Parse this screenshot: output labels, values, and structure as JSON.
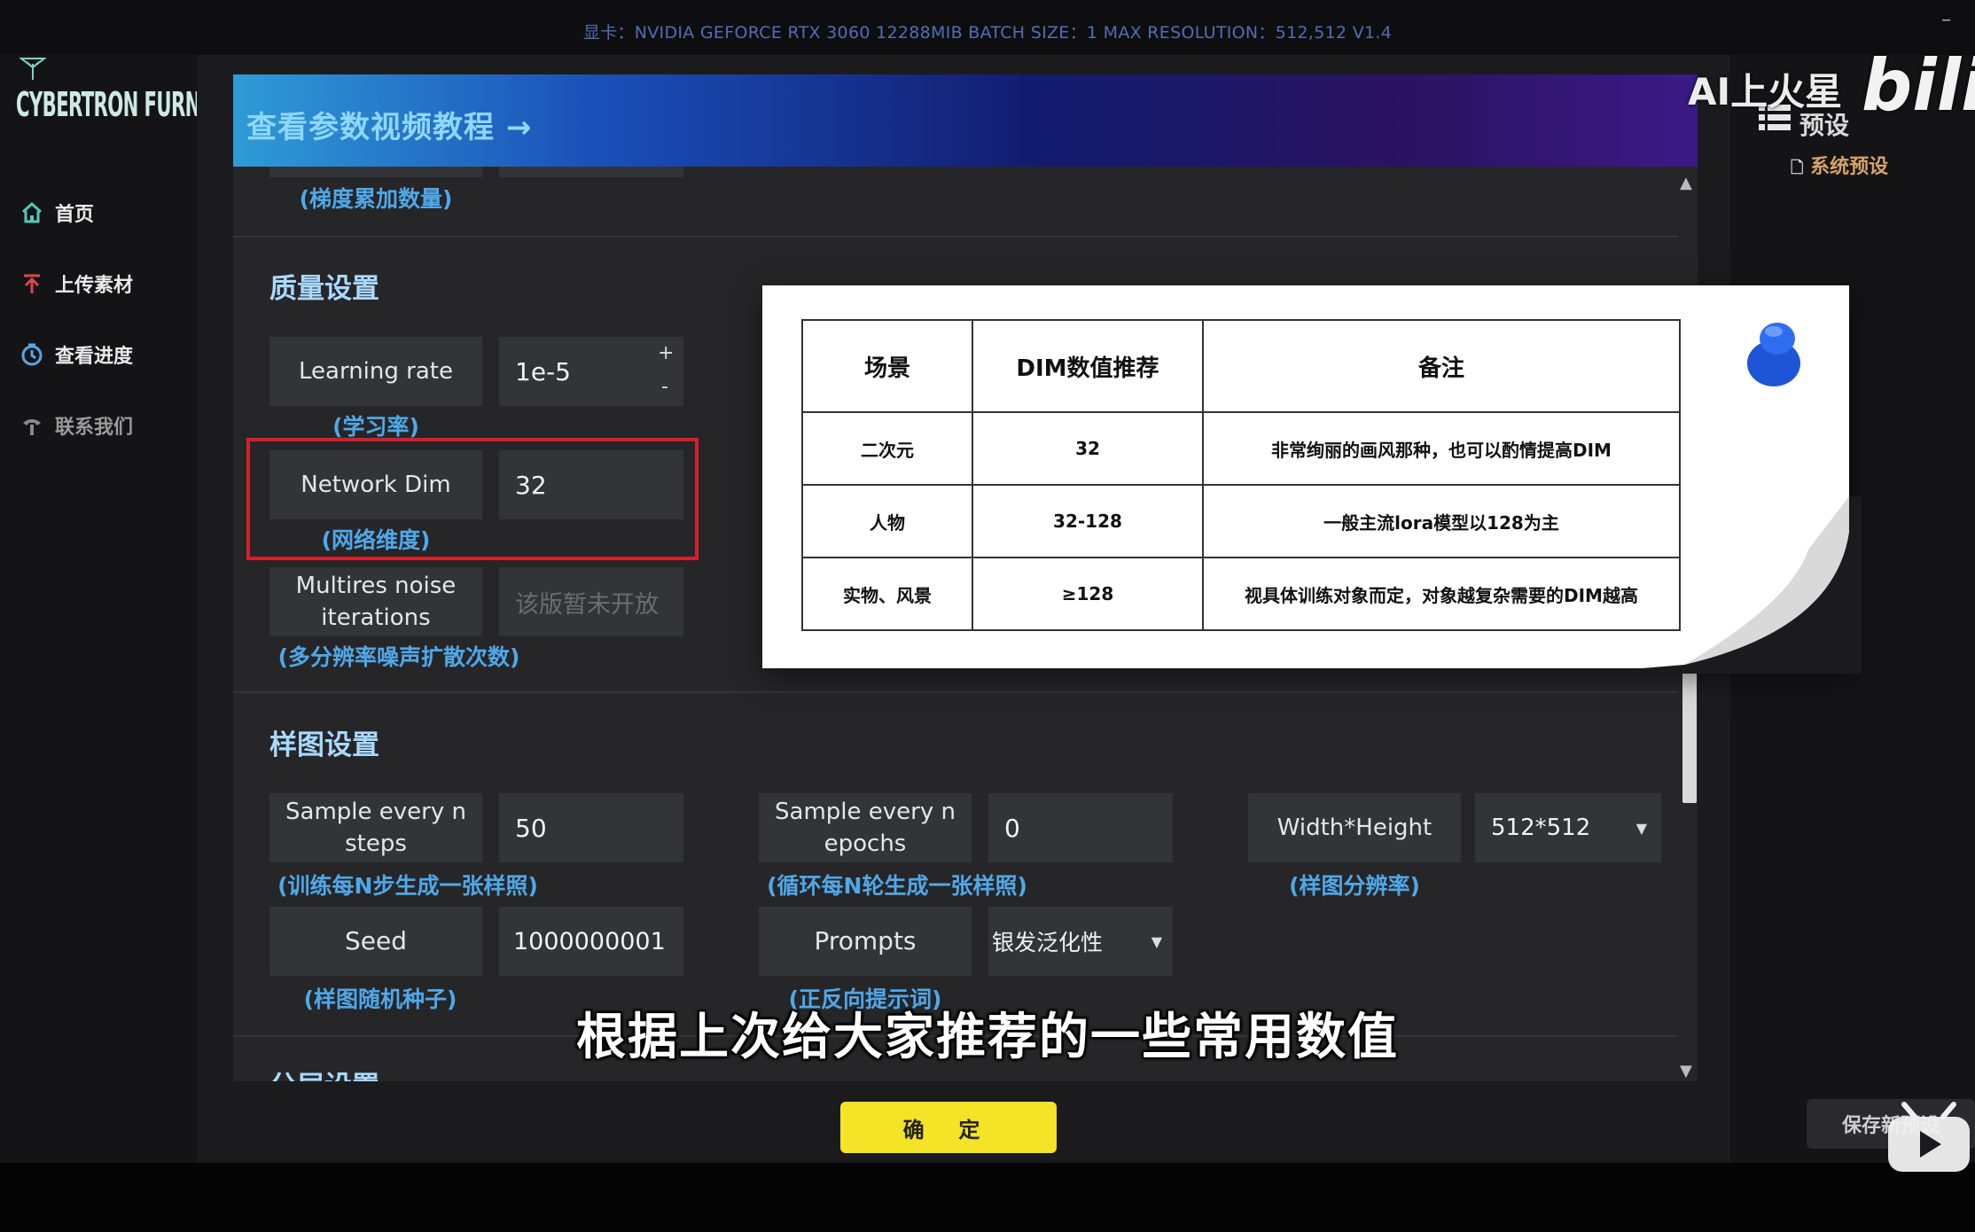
{
  "topbar": {
    "text": "显卡：NVIDIA GEFORCE RTX 3060 12288MIB  BATCH SIZE：1 MAX RESOLUTION：512,512 V1.4",
    "minimize": "–"
  },
  "logo": {
    "text": "CYBERTRON FURNACE"
  },
  "nav": [
    {
      "label": "首页",
      "icon": "home-icon",
      "color": "#eaeaea"
    },
    {
      "label": "上传素材",
      "icon": "upload-icon",
      "color": "#eaeaea"
    },
    {
      "label": "查看进度",
      "icon": "progress-icon",
      "color": "#eaeaea"
    },
    {
      "label": "联系我们",
      "icon": "phone-icon",
      "color": "#9a9a9a"
    }
  ],
  "banner": {
    "text": "查看参数视频教程 →"
  },
  "top_partial": {
    "hint": "(梯度累加数量)"
  },
  "quality": {
    "title": "质量设置",
    "learning_rate": {
      "label": "Learning rate",
      "value": "1e-5",
      "hint": "(学习率)",
      "plus": "+",
      "minus": "-"
    },
    "network_dim": {
      "label": "Network Dim",
      "value": "32",
      "hint": "(网络维度)"
    },
    "multires": {
      "label": "Multires noise iterations",
      "value": "该版暂未开放",
      "hint": "(多分辨率噪声扩散次数)"
    }
  },
  "sample": {
    "title": "样图设置",
    "steps": {
      "label": "Sample every n steps",
      "value": "50",
      "hint": "(训练每N步生成一张样照)"
    },
    "epochs": {
      "label": "Sample every n epochs",
      "value": "0",
      "hint": "(循环每N轮生成一张样照)"
    },
    "size": {
      "label": "Width*Height",
      "value": "512*512",
      "hint": "(样图分辨率)"
    },
    "seed": {
      "label": "Seed",
      "value": "1000000001",
      "hint": "(样图随机种子)"
    },
    "prompts": {
      "label": "Prompts",
      "value": "银发泛化性",
      "hint": "(正反向提示词)"
    }
  },
  "next_section_partial": "分层设置",
  "confirm_label": "确 定",
  "save_preset_label": "保存新预设",
  "preset_label": "预设",
  "system_preset_label": "系统预设",
  "table": {
    "headers": [
      "场景",
      "DIM数值推荐",
      "备注"
    ],
    "rows": [
      [
        "二次元",
        "32",
        "非常绚丽的画风那种，也可以酌情提高DIM"
      ],
      [
        "人物",
        "32-128",
        "一般主流lora模型以128为主"
      ],
      [
        "实物、风景",
        "≥128",
        "视具体训练对象而定，对象越复杂需要的DIM越高"
      ]
    ]
  },
  "subtitle": "根据上次给大家推荐的一些常用数值",
  "watermark": {
    "ai": "AI上火星",
    "bili": "bilib"
  },
  "colors": {
    "accent_blue": "#4fa8e8",
    "highlight_red": "#d4202a",
    "confirm_yellow": "#f4e326"
  }
}
